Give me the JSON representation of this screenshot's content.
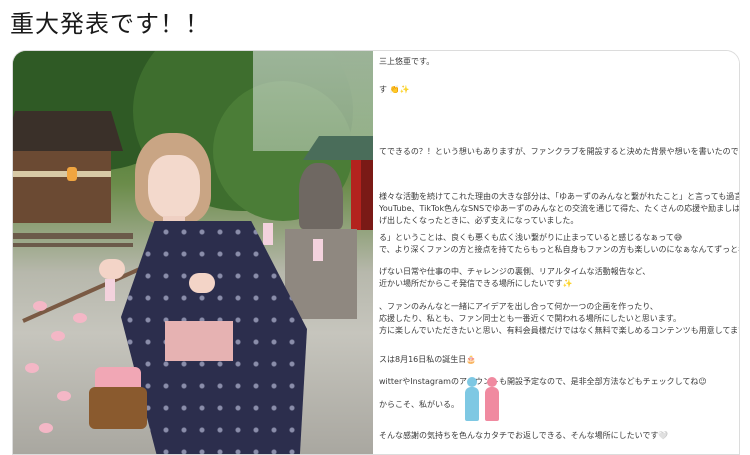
{
  "headline": "重大発表です！！",
  "photo": {
    "subject": ""
  },
  "document": {
    "lines": [
      "三上悠亜です。",
      "す 👏✨",
      "てできるの？！という想いもありますが、ファンクラブを開設すると決めた背景や想いを書いたので、是",
      "様々な活動を続けてこれた理由の大きな部分は、「ゆあーずのみんなと繋がれたこと」と言っても過言で",
      "YouTube、TikTok色んなSNSでゆあーずのみんなとの交流を通じて得た、たくさんの応援や励ましは、",
      "げ出したくなったときに、必ず支えになっていました。",
      "る」ということは、良くも悪くも広く浅い繋がりに止まっていると感じるなぁって😅",
      "で、より深くファンの方と接点を持てたらもっと私自身もファンの方も楽しいのになぁなんてずっと考え",
      "げない日常や仕事の中、チャレンジの裏側、リアルタイムな活動報告など、",
      "近かい場所だからこそ発信できる場所にしたいです✨",
      "、ファンのみんなと一緒にアイデアを出し合って何か一つの企画を作ったり、",
      "応援したり、私とも、ファン同士とも一番近くで関われる場所にしたいと思います。",
      "方に楽しんでいただきたいと思い、有料会員様だけではなく無料で楽しめるコンテンツも用意してます✨",
      "スは8月16日私の誕生日🎂",
      "witterやInstagramのアカウントも開設予定なので、是非全部方法などもチェックしてね😉",
      "からこそ、私がいる。",
      "そんな感謝の気持ちを色んなカタチでお返しできる、そんな場所にしたいです🤍"
    ]
  },
  "colors": {
    "silhouette_blue": "#7ec8e3",
    "silhouette_pink": "#f08aa0"
  }
}
